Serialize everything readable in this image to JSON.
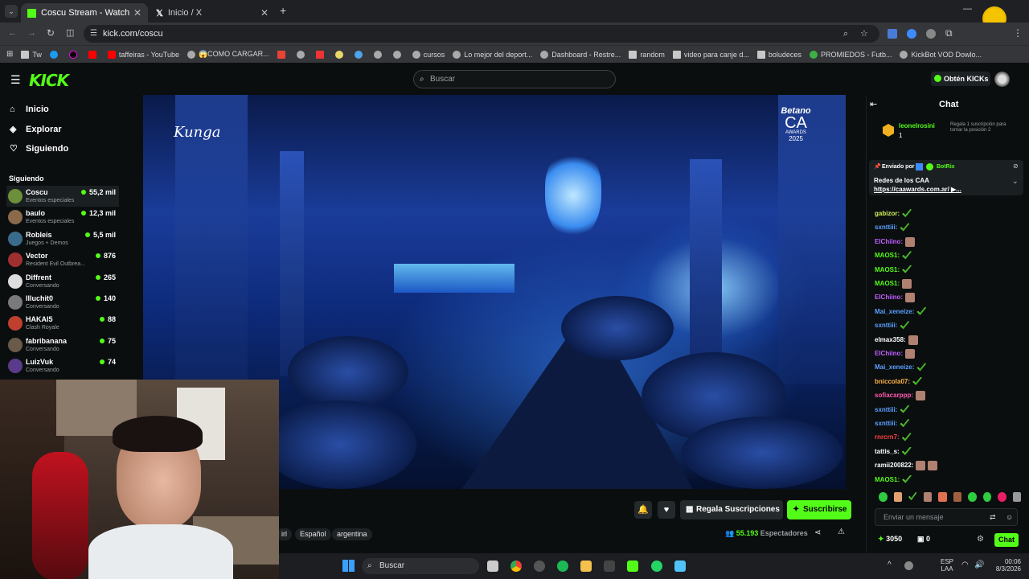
{
  "browser": {
    "tabs": [
      {
        "label": "Coscu Stream - Watch Live on K",
        "active": true
      },
      {
        "label": "Inicio / X",
        "active": false
      }
    ],
    "url": "kick.com/coscu",
    "bookmarks": [
      "Tw",
      "taffeiras - YouTube",
      "😱COMO CARGAR...",
      "cursos",
      "Lo mejor del deport...",
      "Dashboard - Restre...",
      "random",
      "video para canje d...",
      "boludeces",
      "PROMIEDOS - Futb...",
      "KickBot VOD Dowlo..."
    ]
  },
  "kick": {
    "search_placeholder": "Buscar",
    "get_kicks": "Obtén KICKs",
    "nav": [
      {
        "label": "Inicio",
        "icon": "home-icon"
      },
      {
        "label": "Explorar",
        "icon": "compass-icon"
      },
      {
        "label": "Siguiendo",
        "icon": "heart-icon"
      }
    ],
    "following_title": "Siguiendo",
    "channels": [
      {
        "name": "Coscu",
        "category": "Eventos especiales",
        "viewers": "55,2 mil"
      },
      {
        "name": "baulo",
        "category": "Eventos especiales",
        "viewers": "12,3 mil"
      },
      {
        "name": "Robleis",
        "category": "Juegos + Demos",
        "viewers": "5,5 mil"
      },
      {
        "name": "Vector",
        "category": "Resident Evil Outbrea...",
        "viewers": "876"
      },
      {
        "name": "Diffrent",
        "category": "Conversando",
        "viewers": "265"
      },
      {
        "name": "Illuchit0",
        "category": "Conversando",
        "viewers": "140"
      },
      {
        "name": "HAKAI5",
        "category": "Clash Royale",
        "viewers": "88"
      },
      {
        "name": "fabribanana",
        "category": "Conversando",
        "viewers": "75"
      },
      {
        "name": "LuizVuk",
        "category": "Conversando",
        "viewers": "74"
      }
    ],
    "video": {
      "overlay_brand": "Betano",
      "overlay_ca": "CA",
      "overlay_awards": "AWARDS",
      "overlay_year": "2025"
    },
    "actions": {
      "gift": "Regala Suscripciones",
      "subscribe": "Suscribirse",
      "viewers": "55.193",
      "viewers_label": "Espectadores"
    },
    "tags": [
      "irl",
      "Español",
      "argentina"
    ],
    "chat": {
      "title": "Chat",
      "gift_user": "leonelrosini",
      "gift_count": "1",
      "gift_text": "Regala 1 suscripción para tomar la posición 2",
      "pinned_by_label": "Enviado por",
      "pinned_by": "BotRix",
      "pinned_text": "Redes de los CAA",
      "pinned_link": "https://caawards.com.ar/ ▶...",
      "messages": [
        {
          "user": "gabizor:",
          "color": "#d4f05a"
        },
        {
          "user": "sxnttiii:",
          "color": "#5aa0ff"
        },
        {
          "user": "ElChiino:",
          "color": "#c060ff"
        },
        {
          "user": "MAOS1:",
          "color": "#53fc18"
        },
        {
          "user": "MAOS1:",
          "color": "#53fc18"
        },
        {
          "user": "MAOS1:",
          "color": "#53fc18"
        },
        {
          "user": "ElChiino:",
          "color": "#c060ff"
        },
        {
          "user": "Mai_xeneize:",
          "color": "#5aa0ff"
        },
        {
          "user": "sxnttiii:",
          "color": "#5aa0ff"
        },
        {
          "user": "elmax358:",
          "color": "#ffffff"
        },
        {
          "user": "ElChiino:",
          "color": "#c060ff"
        },
        {
          "user": "Mai_xeneize:",
          "color": "#5aa0ff"
        },
        {
          "user": "bniccola07:",
          "color": "#ffb347"
        },
        {
          "user": "sofiacarppp:",
          "color": "#ff5ab0"
        },
        {
          "user": "sxnttiii:",
          "color": "#5aa0ff"
        },
        {
          "user": "sxnttiii:",
          "color": "#5aa0ff"
        },
        {
          "user": "rnrcrn7:",
          "color": "#ff4040"
        },
        {
          "user": "tattis_s:",
          "color": "#ffffff"
        },
        {
          "user": "ramii200822:",
          "color": "#ffffff"
        },
        {
          "user": "MAOS1:",
          "color": "#53fc18"
        }
      ],
      "input_placeholder": "Enviar un mensaje",
      "kicks": "3050",
      "chests": "0",
      "send_label": "Chat"
    }
  },
  "taskbar": {
    "search": "Buscar",
    "lang": "ESP",
    "lang2": "LAA",
    "time": "00:06",
    "date": "8/3/2026"
  }
}
